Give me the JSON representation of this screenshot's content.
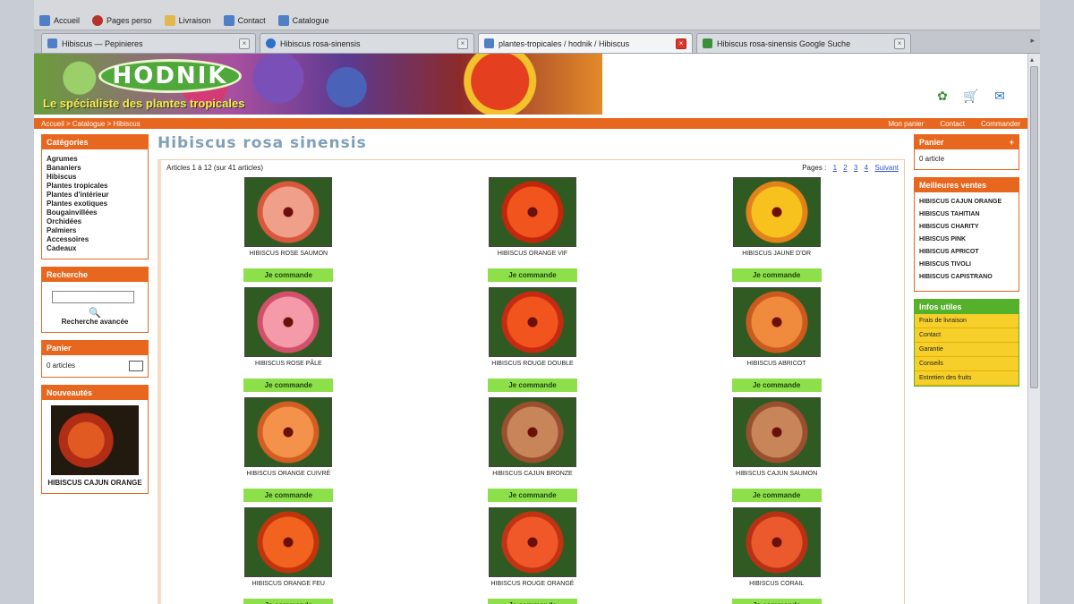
{
  "bookmarks": [
    "Accueil",
    "Pages perso",
    "Livraison",
    "Contact",
    "Catalogue"
  ],
  "tabs": [
    {
      "label": "Hibiscus — Pepinieres",
      "active": false
    },
    {
      "label": "Hibiscus rosa-sinensis",
      "active": false
    },
    {
      "label": "plantes-tropicales / hodnik / Hibiscus",
      "active": true
    },
    {
      "label": "Hibiscus rosa-sinensis Google Suche",
      "active": false
    }
  ],
  "header": {
    "logo": "HODNIK",
    "tagline": "Le spécialiste des plantes tropicales",
    "breadcrumb": "Accueil > Catalogue > Hibiscus",
    "links": [
      "Mon panier",
      "Contact",
      "Commander"
    ]
  },
  "left": {
    "categories_title": "Catégories",
    "categories": [
      "Agrumes",
      "Bananiers",
      "Hibiscus",
      "Plantes tropicales",
      "Plantes d'intérieur",
      "Plantes exotiques",
      "Bougainvillées",
      "Orchidées",
      "Palmiers",
      "Accessoires",
      "Cadeaux"
    ],
    "search_title": "Recherche",
    "search_advanced": "Recherche avancée",
    "cart_title": "Panier",
    "cart_text": "0 articles",
    "promo_title": "Nouveautés",
    "promo_text": "HIBISCUS CAJUN ORANGE"
  },
  "center": {
    "title": "Hibiscus rosa sinensis",
    "count_text": "Articles 1 à 12 (sur 41 articles)",
    "pages_label": "Pages :",
    "pages": [
      "1",
      "2",
      "3",
      "4",
      "Suivant"
    ],
    "products": [
      {
        "name": "Hibiscus rose saumon",
        "order": "Je commande"
      },
      {
        "name": "Hibiscus orange vif",
        "order": "Je commande"
      },
      {
        "name": "Hibiscus jaune d'or",
        "order": "Je commande"
      },
      {
        "name": "Hibiscus rose pâle",
        "order": "Je commande"
      },
      {
        "name": "Hibiscus rouge double",
        "order": "Je commande"
      },
      {
        "name": "Hibiscus abricot",
        "order": "Je commande"
      },
      {
        "name": "Hibiscus orange cuivré",
        "order": "Je commande"
      },
      {
        "name": "Hibiscus cajun bronze",
        "order": "Je commande"
      },
      {
        "name": "Hibiscus cajun saumon",
        "order": "Je commande"
      },
      {
        "name": "Hibiscus orange feu",
        "order": "Je commande"
      },
      {
        "name": "Hibiscus rouge orangé",
        "order": "Je commande"
      },
      {
        "name": "Hibiscus corail",
        "order": "Je commande"
      }
    ]
  },
  "right": {
    "cart_title": "Panier",
    "cart_text": "0 article",
    "best_title": "Meilleures ventes",
    "best": [
      {
        "name": "HIBISCUS CAJUN ORANGE"
      },
      {
        "name": "HIBISCUS TAHITIAN"
      },
      {
        "name": "HIBISCUS CHARITY"
      },
      {
        "name": "HIBISCUS PINK"
      },
      {
        "name": "HIBISCUS APRICOT"
      },
      {
        "name": "HIBISCUS TIVOLI"
      },
      {
        "name": "HIBISCUS CAPISTRANO"
      }
    ],
    "info_title": "Infos utiles",
    "info": [
      "Frais de livraison",
      "Contact",
      "Garantie",
      "Conseils",
      "Entretien des fruits"
    ]
  }
}
